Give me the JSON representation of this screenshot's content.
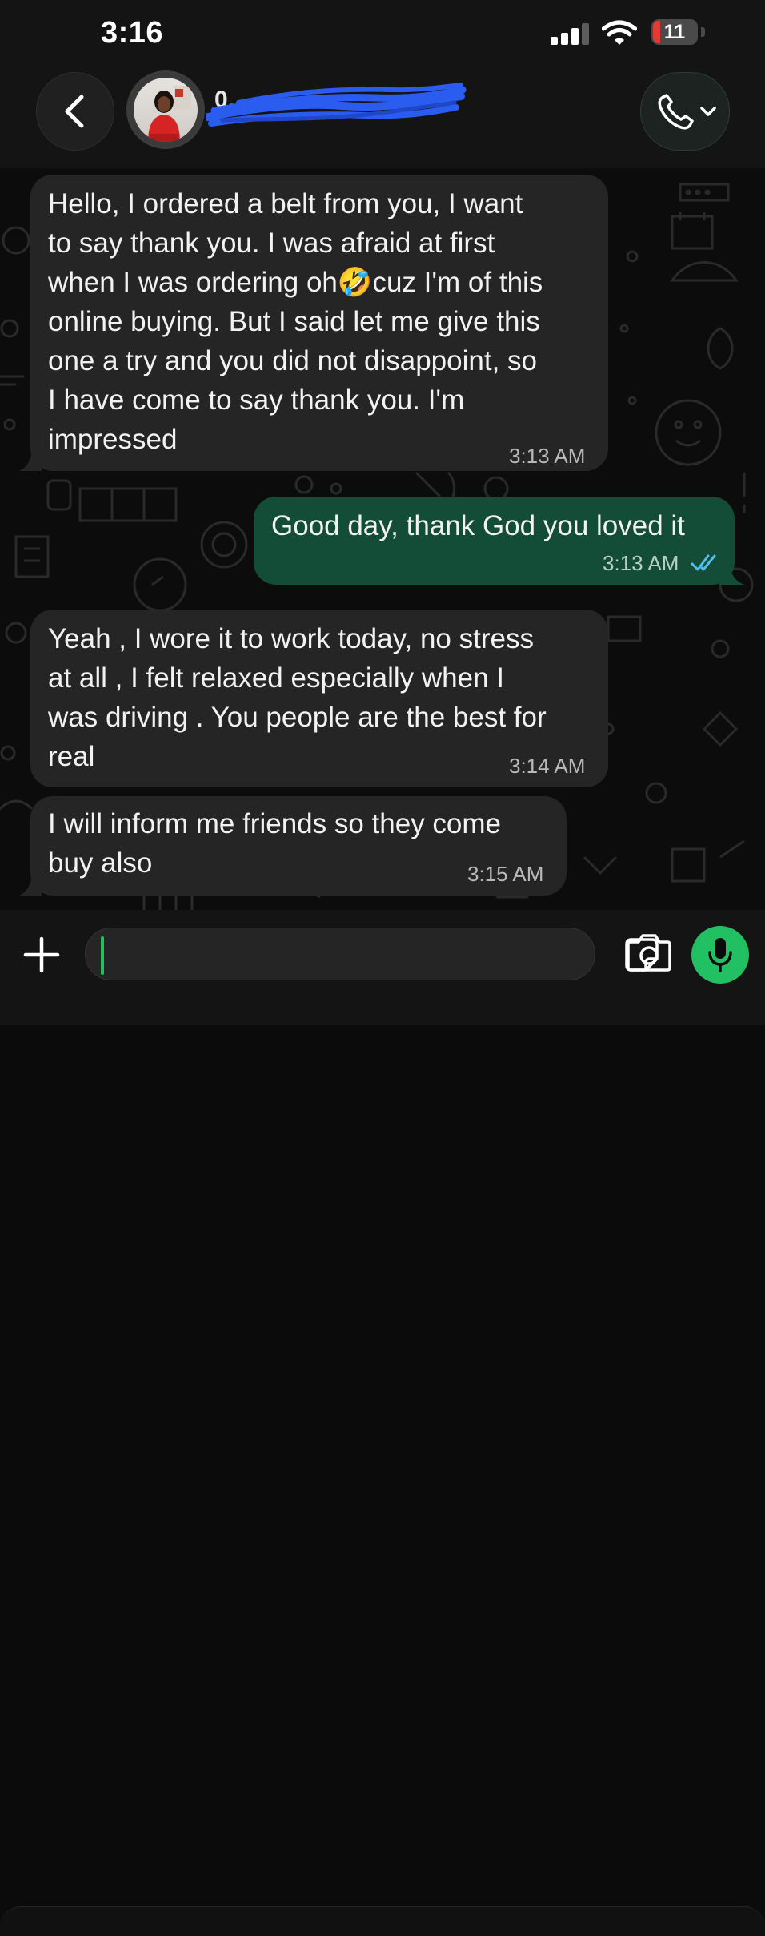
{
  "status_bar": {
    "time": "3:16",
    "battery_level": "11",
    "battery_color": "#e53935"
  },
  "header": {
    "back_icon": "chevron-left-icon",
    "contact_name": "0…",
    "contact_name_obscured": true,
    "call_icon": "phone-dropdown-icon"
  },
  "messages": [
    {
      "direction": "incoming",
      "text": "Hello, I ordered a belt from you, I want\nto say thank you. I was afraid at first\nwhen I was ordering oh🤣cuz I'm of this\nonline buying. But I said let me give this\none a try and you did not disappoint, so\nI have come to say thank you. I'm\nimpressed",
      "time": "3:13 AM"
    },
    {
      "direction": "outgoing",
      "text": "Good day, thank God you loved it",
      "time": "3:13 AM",
      "read_receipt": "double-check-icon",
      "read_receipt_color": "#53bdeb"
    },
    {
      "direction": "incoming",
      "text": "Yeah , I wore it to work today, no stress\nat all , I felt relaxed especially when I\nwas driving . You people are the best for\nreal",
      "time": "3:14 AM"
    },
    {
      "direction": "incoming",
      "text": "I will inform me friends so they come\nbuy also",
      "time": "3:15 AM"
    }
  ],
  "composer": {
    "input_value": "",
    "accent_color": "#21c063"
  },
  "colors": {
    "incoming_bubble": "#252525",
    "outgoing_bubble": "#144d37",
    "background": "#0b0b0b"
  }
}
